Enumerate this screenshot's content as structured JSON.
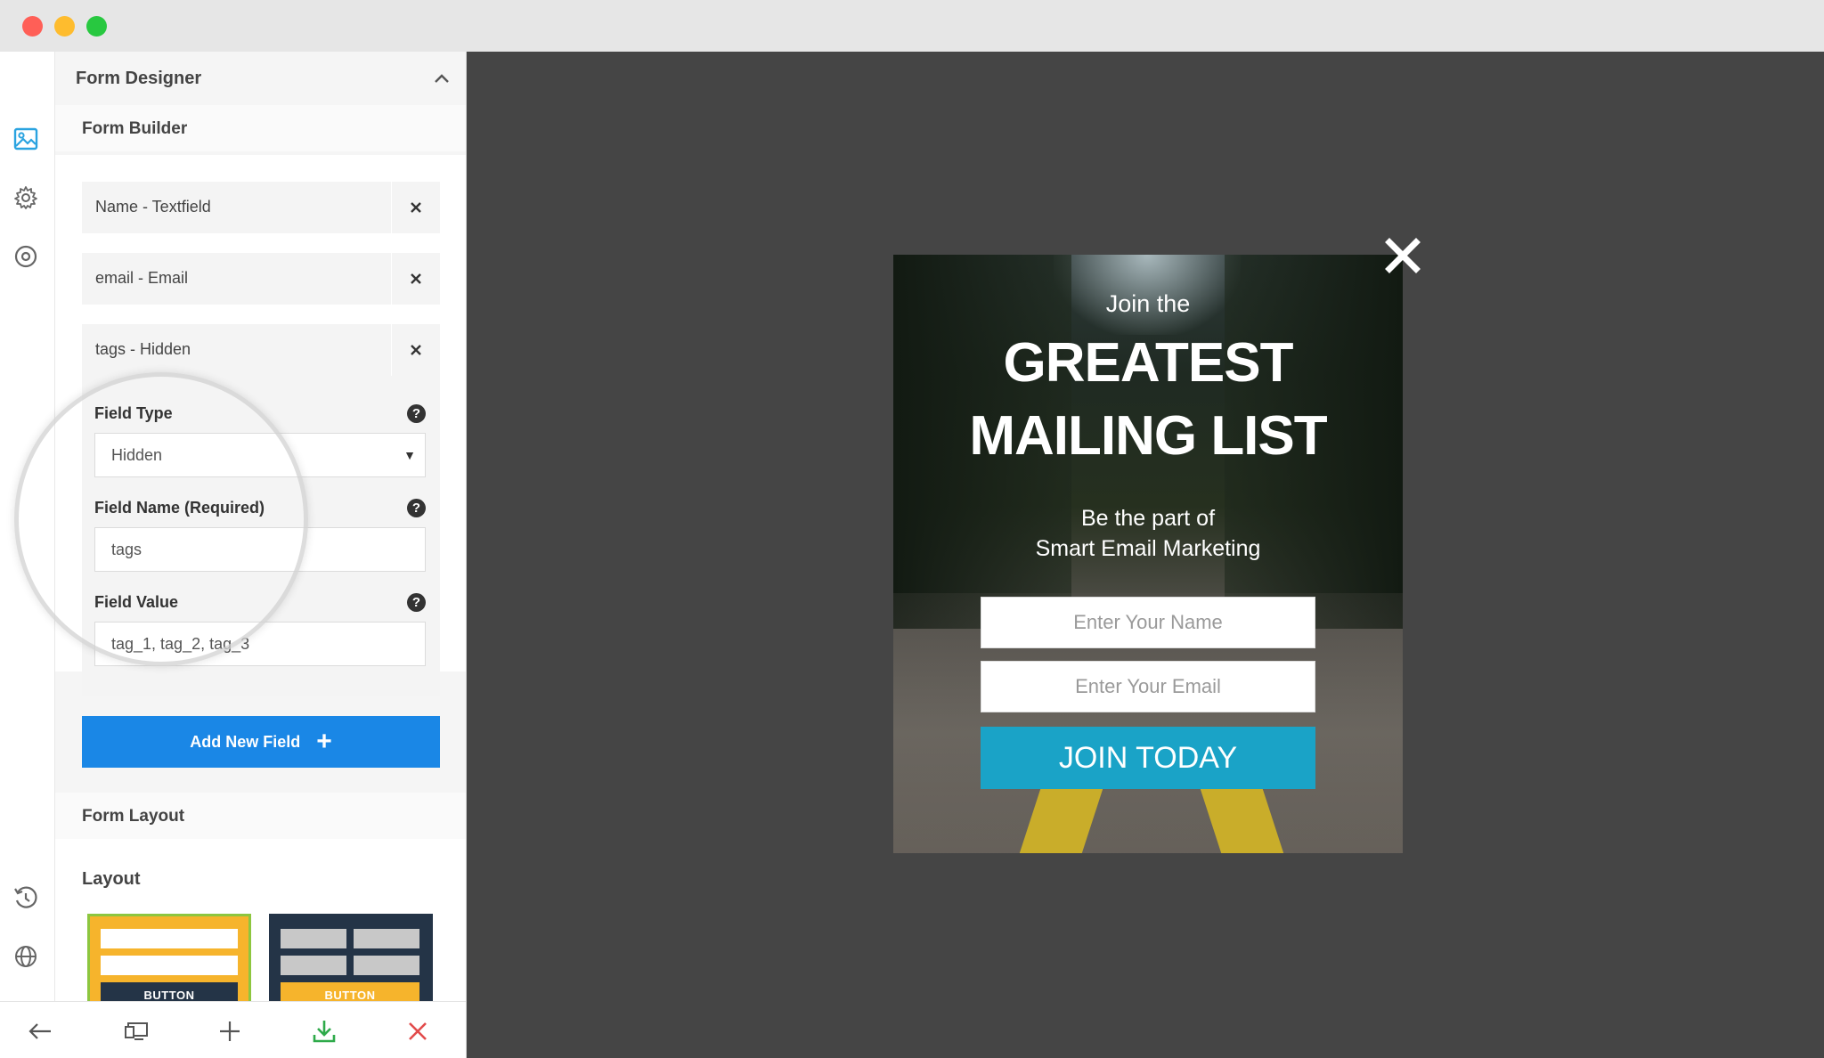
{
  "panel": {
    "title": "Form Designer"
  },
  "form_builder": {
    "title": "Form Builder",
    "fields": [
      {
        "label": "Name - Textfield"
      },
      {
        "label": "email - Email"
      },
      {
        "label": "tags - Hidden"
      }
    ],
    "expanded_field": {
      "type_label": "Field Type",
      "type_value": "Hidden",
      "name_label": "Field Name (Required)",
      "name_value": "tags",
      "value_label": "Field Value",
      "value_value": "tag_1, tag_2, tag_3"
    },
    "add_button_label": "Add New Field"
  },
  "form_layout": {
    "title": "Form Layout",
    "layout_label": "Layout",
    "thumbnails": [
      {
        "button_text": "BUTTON",
        "selected": true,
        "bg": "#f6b42c",
        "btn_bg": "#243447"
      },
      {
        "button_text": "BUTTON",
        "selected": false,
        "bg": "#243447",
        "btn_bg": "#f6b42c"
      }
    ]
  },
  "popup": {
    "line1": "Join the",
    "line2": "GREATEST",
    "line3": "MAILING LIST",
    "sub1": "Be the part of",
    "sub2": "Smart Email Marketing",
    "name_placeholder": "Enter Your Name",
    "email_placeholder": "Enter Your Email",
    "button_label": "JOIN TODAY",
    "button_color": "#1aa3c7"
  },
  "colors": {
    "accent": "#1a87e6",
    "canvas": "#454545",
    "download_icon": "#2eaa4a",
    "close_icon": "#e24b4b"
  },
  "icons": {
    "rail_top": [
      "image-icon",
      "gear-icon",
      "target-icon"
    ],
    "rail_bottom": [
      "history-icon",
      "globe-icon"
    ],
    "bottom_toolbar": [
      "back-arrow-icon",
      "monitor-icon",
      "plus-icon",
      "download-icon",
      "close-icon"
    ]
  }
}
